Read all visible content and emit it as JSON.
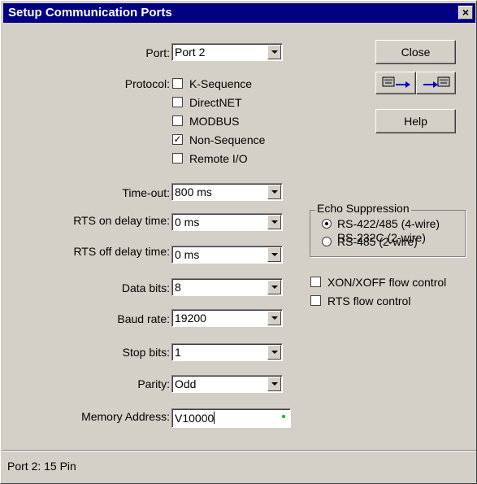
{
  "window": {
    "title": "Setup Communication Ports",
    "close_glyph": "×"
  },
  "port": {
    "label": "Port:",
    "value": "Port 2"
  },
  "protocol": {
    "label": "Protocol:",
    "options": [
      {
        "label": "K-Sequence",
        "checked": false
      },
      {
        "label": "DirectNET",
        "checked": false
      },
      {
        "label": "MODBUS",
        "checked": false
      },
      {
        "label": "Non-Sequence",
        "checked": true
      },
      {
        "label": "Remote I/O",
        "checked": false
      }
    ]
  },
  "fields": {
    "timeout": {
      "label": "Time-out:",
      "value": "800 ms"
    },
    "rts_on": {
      "label": "RTS on delay time:",
      "value": "0 ms"
    },
    "rts_off": {
      "label": "RTS off delay time:",
      "value": "0 ms"
    },
    "data_bits": {
      "label": "Data bits:",
      "value": "8"
    },
    "baud_rate": {
      "label": "Baud rate:",
      "value": "19200"
    },
    "stop_bits": {
      "label": "Stop bits:",
      "value": "1"
    },
    "parity": {
      "label": "Parity:",
      "value": "Odd"
    },
    "memory_address": {
      "label": "Memory Address:",
      "value": "V10000"
    }
  },
  "buttons": {
    "close": "Close",
    "help": "Help"
  },
  "echo_suppression": {
    "title": "Echo Suppression",
    "opt1_line1": "RS-422/485 (4-wire)",
    "opt1_line2": "RS-232C (2-wire)",
    "opt2": "RS-485 (2-wire)",
    "selected": "opt1"
  },
  "flow_control": {
    "xon_xoff": {
      "label": "XON/XOFF flow control",
      "checked": false
    },
    "rts": {
      "label": "RTS flow control",
      "checked": false
    }
  },
  "status": {
    "text": "Port 2: 15 Pin"
  },
  "icons": {
    "read": "read-from-plc-icon",
    "write": "write-to-plc-icon",
    "dropdown": "dropdown-arrow-icon"
  },
  "colors": {
    "titlebar": "#000080",
    "face": "#d4d0c8"
  }
}
